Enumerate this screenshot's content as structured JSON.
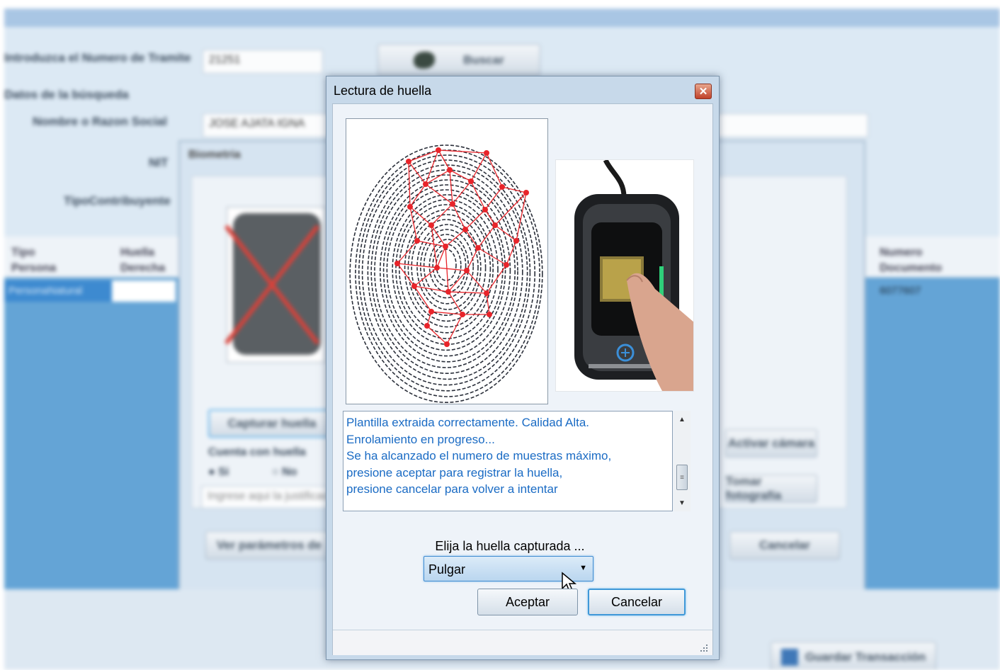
{
  "background": {
    "tramite_label": "Introduzca el Numero de Tramite",
    "tramite_value": "21251",
    "search_button": "Buscar",
    "results_label": "Datos de la búsqueda",
    "name_label": "Nombre o Razon Social",
    "name_value": "JOSE AJATA IGNA",
    "nit_label": "NIT",
    "taxpayer_label": "TipoContribuyente",
    "grid_headers": {
      "tipo_persona": "Tipo Persona",
      "huella_derecha": "Huella Derecha",
      "numero_documento": "Numero Documento"
    },
    "grid_row": {
      "tipo_persona": "PersonaNatural",
      "numero_documento": "6077607"
    },
    "biometria_window": {
      "title": "Biometria",
      "capture_button": "Capturar huella",
      "has_fingerprint_label": "Cuenta con huella",
      "option_yes": "Si",
      "option_no": "No",
      "reason_placeholder": "Ingrese aqui la justificacion",
      "params_button": "Ver parámetros de",
      "camera_button": "Activar cámara",
      "photo_button": "Tomar fotografía",
      "cancel_button": "Cancelar"
    },
    "save_button": "Guardar Transacción"
  },
  "dialog": {
    "title": "Lectura de huella",
    "log_lines": [
      "Plantilla extraida correctamente. Calidad Alta.",
      "Enrolamiento en progreso...",
      "Se ha alcanzado el numero de muestras máximo,",
      "presione aceptar para registrar la huella,",
      "presione cancelar para volver a intentar"
    ],
    "choose_label": "Elija la huella capturada ...",
    "finger_select_value": "Pulgar",
    "accept_button": "Aceptar",
    "cancel_button": "Cancelar"
  },
  "colors": {
    "log_text": "#1a6bc4",
    "minutiae": "#e8242a",
    "selection_blue": "#64a4d6"
  }
}
